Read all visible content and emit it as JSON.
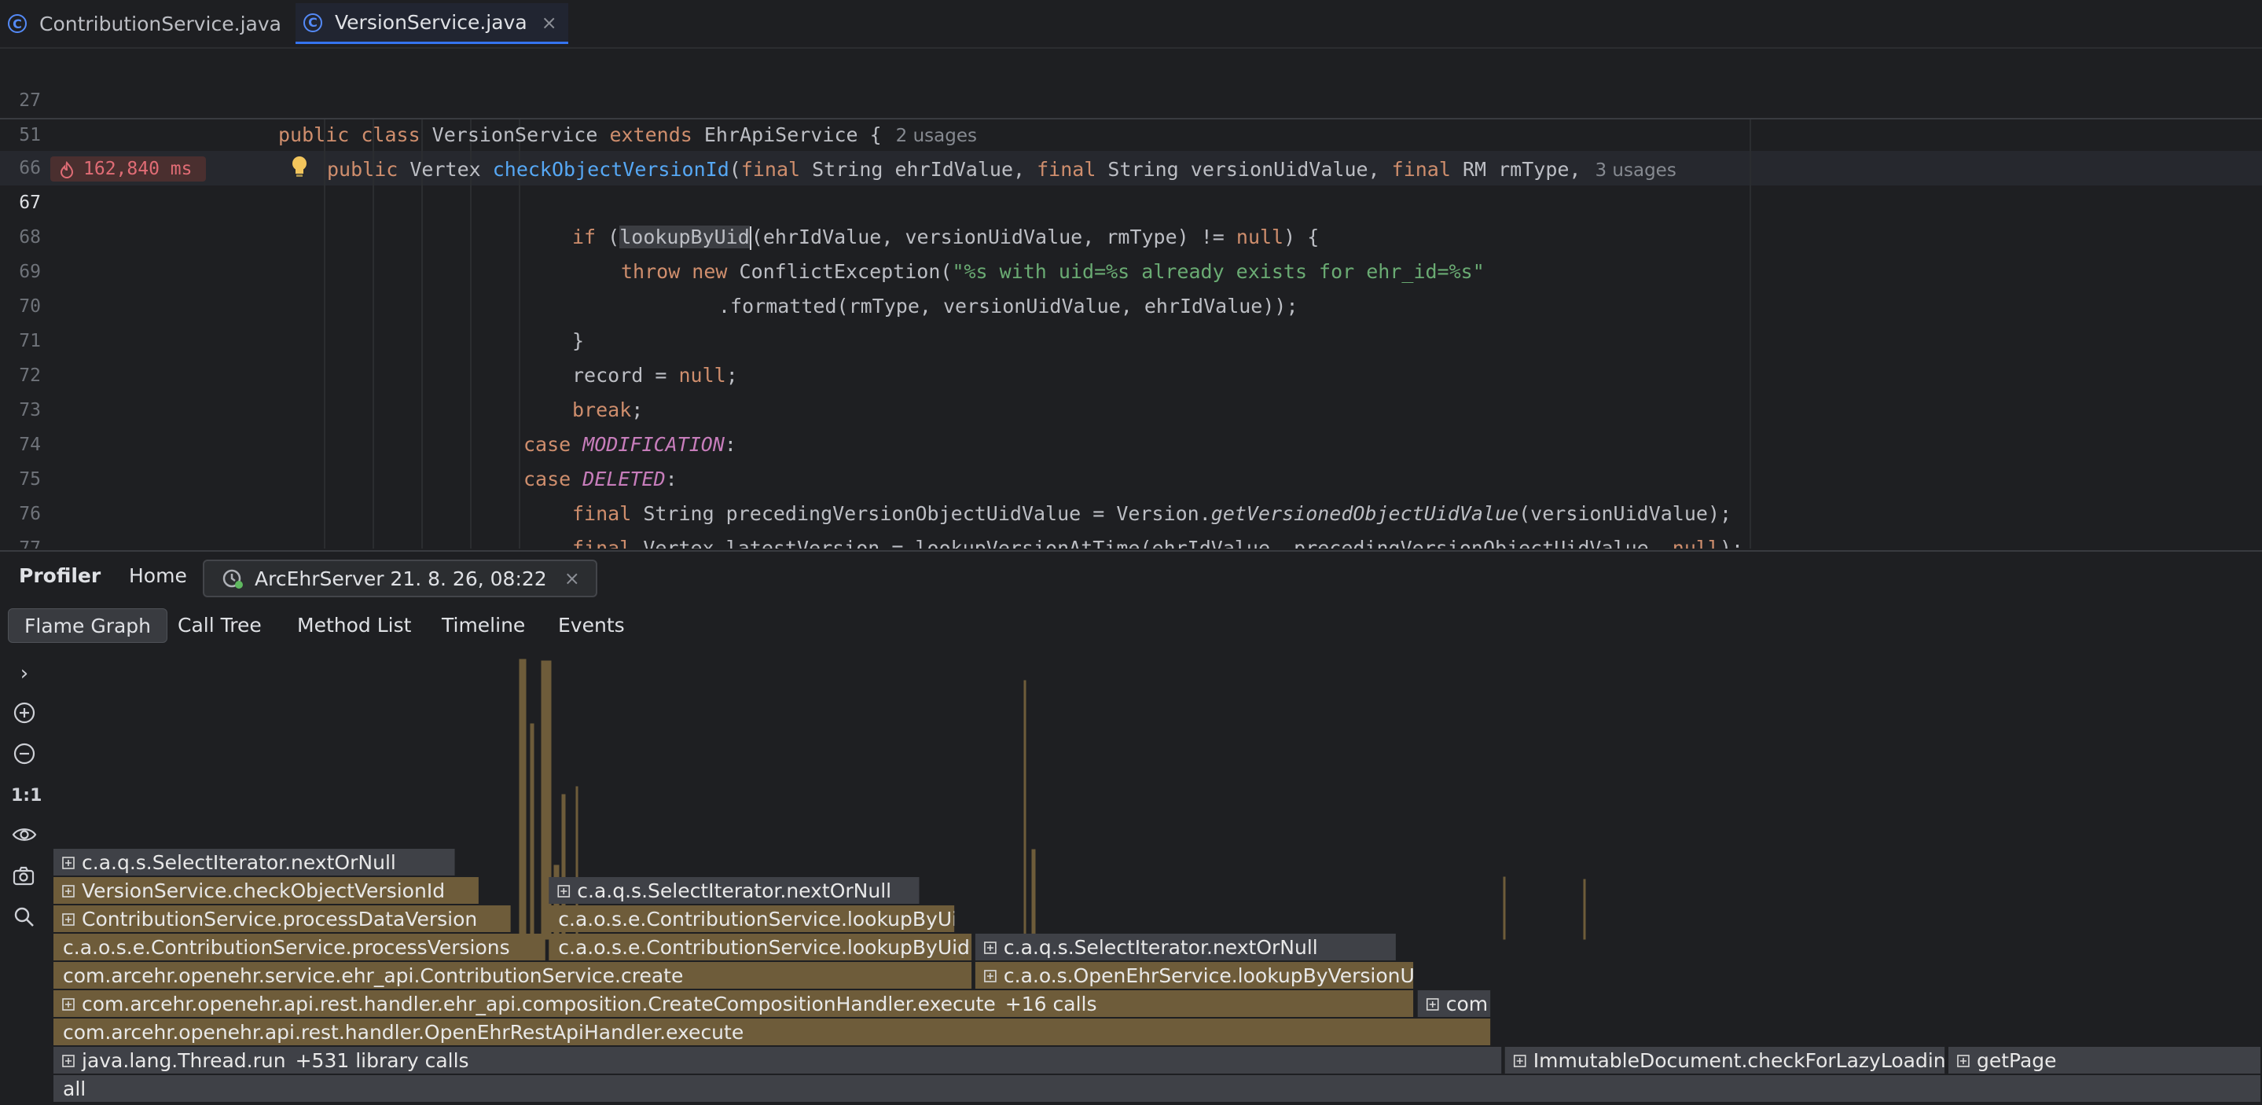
{
  "editor_tabs": [
    {
      "label": "ContributionService.java",
      "active": false
    },
    {
      "label": "VersionService.java",
      "active": true
    }
  ],
  "editor": {
    "sticky": [
      {
        "ln": "27",
        "hint": "2 usages"
      },
      {
        "ln": "51",
        "hint": "3 usages"
      }
    ],
    "lines": [
      "66",
      "67",
      "68",
      "69",
      "70",
      "71",
      "72",
      "73",
      "74",
      "75",
      "76",
      "77"
    ],
    "time_badge": "162,840 ms"
  },
  "profiler": {
    "title": "Profiler",
    "home": "Home",
    "session": "ArcEhrServer 21. 8. 26, 08:22",
    "views": [
      "Flame Graph",
      "Call Tree",
      "Method List",
      "Timeline",
      "Events"
    ],
    "active_view": "Flame Graph",
    "zoom_reset": "1:1",
    "frames": [
      {
        "label": "all",
        "level": 0,
        "start": 0,
        "end": 1.0,
        "kind": "gray",
        "expandable": false
      },
      {
        "label": "java.lang.Thread.run",
        "extra": "+531 library calls",
        "level": 1,
        "start": 0,
        "end": 0.6563,
        "kind": "gray",
        "expandable": true
      },
      {
        "label": "ImmutableDocument.checkForLazyLoading",
        "level": 1,
        "start": 0.6572,
        "end": 0.857,
        "kind": "gray",
        "expandable": true
      },
      {
        "label": "getPage",
        "level": 1,
        "start": 0.858,
        "end": 1.0,
        "kind": "gray",
        "expandable": true
      },
      {
        "label": "com.arcehr.openehr.api.rest.handler.OpenEhrRestApiHandler.execute",
        "level": 2,
        "start": 0,
        "end": 0.6513,
        "kind": "gold",
        "expandable": false
      },
      {
        "label": "com.arcehr.openehr.api.rest.handler.ehr_api.composition.CreateCompositionHandler.execute",
        "extra": "+16 calls",
        "level": 3,
        "start": 0,
        "end": 0.6164,
        "kind": "gold",
        "expandable": true
      },
      {
        "label": "com",
        "level": 3,
        "start": 0.6177,
        "end": 0.6513,
        "kind": "gray",
        "expandable": true
      },
      {
        "label": "com.arcehr.openehr.service.ehr_api.ContributionService.create",
        "level": 4,
        "start": 0,
        "end": 0.4164,
        "kind": "gold",
        "expandable": false
      },
      {
        "label": "c.a.o.s.OpenEhrService.lookupByVersionUid",
        "level": 4,
        "start": 0.4174,
        "end": 0.6164,
        "kind": "gold",
        "expandable": true
      },
      {
        "label": "c.a.o.s.e.ContributionService.processVersions",
        "level": 5,
        "start": 0,
        "end": 0.2234,
        "kind": "gold",
        "expandable": false
      },
      {
        "label": "c.a.o.s.e.ContributionService.lookupByUid",
        "level": 5,
        "start": 0.2243,
        "end": 0.4164,
        "kind": "gold",
        "expandable": false
      },
      {
        "label": "c.a.q.s.SelectIterator.nextOrNull",
        "level": 5,
        "start": 0.4174,
        "end": 0.6085,
        "kind": "gray",
        "expandable": true
      },
      {
        "label": "ContributionService.processDataVersion",
        "level": 6,
        "start": 0,
        "end": 0.2077,
        "kind": "gold",
        "expandable": true
      },
      {
        "label": "c.a.o.s.e.ContributionService.lookupByUid",
        "level": 6,
        "start": 0.2243,
        "end": 0.4086,
        "kind": "gold",
        "expandable": false
      },
      {
        "label": "VersionService.checkObjectVersionId",
        "level": 7,
        "start": 0,
        "end": 0.1932,
        "kind": "gold",
        "expandable": true
      },
      {
        "label": "c.a.q.s.SelectIterator.nextOrNull",
        "level": 7,
        "start": 0.2243,
        "end": 0.3927,
        "kind": "gray",
        "expandable": true
      },
      {
        "label": "c.a.q.s.SelectIterator.nextOrNull",
        "level": 8,
        "start": 0,
        "end": 0.1824,
        "kind": "gray",
        "expandable": true
      }
    ]
  }
}
